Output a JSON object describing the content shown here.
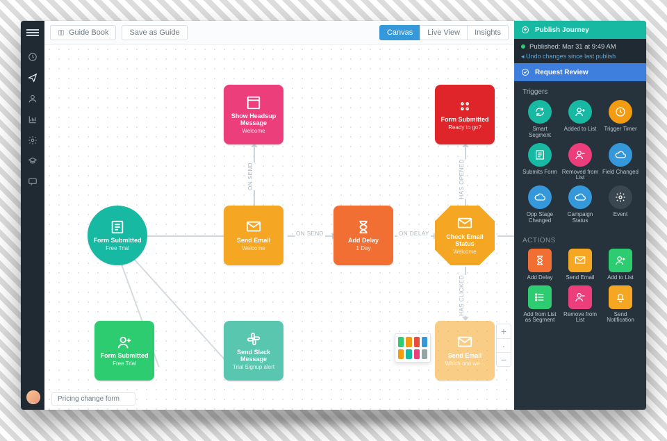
{
  "toolbar": {
    "guide_book": "Guide Book",
    "save_guide": "Save as Guide",
    "tabs": {
      "canvas": "Canvas",
      "live": "Live View",
      "insights": "Insights"
    }
  },
  "nodes": {
    "start": {
      "title": "Form Submitted",
      "sub": "Free Trial"
    },
    "headsup": {
      "title": "Show Headsup Message",
      "sub": "Welcome"
    },
    "send_email": {
      "title": "Send Email",
      "sub": "Welcome"
    },
    "delay": {
      "title": "Add Delay",
      "sub": "1 Day"
    },
    "check_status": {
      "title": "Check Email Status",
      "sub": "Welcome"
    },
    "form_top": {
      "title": "Form Submitted",
      "sub": "Ready to go?"
    },
    "form_bottom": {
      "title": "Form Submitted",
      "sub": "Free Trial"
    },
    "slack": {
      "title": "Send Slack Message",
      "sub": "Trial Signup alert"
    },
    "ghost_email": {
      "title": "Send Email",
      "sub": "Which one we..."
    }
  },
  "edges": {
    "e1": "ON SEND",
    "e2": "ON SEND",
    "e3": "ON DELAY",
    "e4": "HAS OPENED",
    "e5": "HAS CLICKED"
  },
  "journey_name": "Pricing change form",
  "panel": {
    "publish": "Publish Journey",
    "published_line": "Published: Mar 31 at 9:49 AM",
    "undo": "Undo changes since last publish",
    "review": "Request Review",
    "triggers_h": "Triggers",
    "actions_h": "ACTIONS",
    "triggers": [
      {
        "key": "smart-segment",
        "label": "Smart Segment",
        "color": "c-teal",
        "icon": "refresh"
      },
      {
        "key": "added-list",
        "label": "Added to List",
        "color": "c-teal",
        "icon": "user-plus"
      },
      {
        "key": "trigger-timer",
        "label": "Trigger Timer",
        "color": "c-orange",
        "icon": "clock"
      },
      {
        "key": "submits-form",
        "label": "Submits Form",
        "color": "c-teal",
        "icon": "form"
      },
      {
        "key": "removed-list",
        "label": "Removed from List",
        "color": "c-pink",
        "icon": "user-minus"
      },
      {
        "key": "field-changed",
        "label": "Field Changed",
        "color": "c-blue",
        "icon": "cloud"
      },
      {
        "key": "opp-stage",
        "label": "Opp Stage Changed",
        "color": "c-blue",
        "icon": "cloud"
      },
      {
        "key": "camp-status",
        "label": "Campaign Status",
        "color": "c-blue",
        "icon": "cloud"
      },
      {
        "key": "event",
        "label": "Event",
        "color": "c-grey",
        "icon": "gear"
      }
    ],
    "actions": [
      {
        "key": "add-delay",
        "label": "Add Delay",
        "color": "c-dorange",
        "icon": "hourglass"
      },
      {
        "key": "send-email",
        "label": "Send Email",
        "color": "c-amber",
        "icon": "mail"
      },
      {
        "key": "add-list",
        "label": "Add to List",
        "color": "c-green",
        "icon": "user-plus"
      },
      {
        "key": "addfrom",
        "label": "Add from List as Segment",
        "color": "c-green",
        "icon": "list"
      },
      {
        "key": "remove",
        "label": "Remove from List",
        "color": "c-pink",
        "icon": "user-minus"
      },
      {
        "key": "send-notif",
        "label": "Send Notification",
        "color": "c-amber",
        "icon": "bell"
      }
    ]
  }
}
